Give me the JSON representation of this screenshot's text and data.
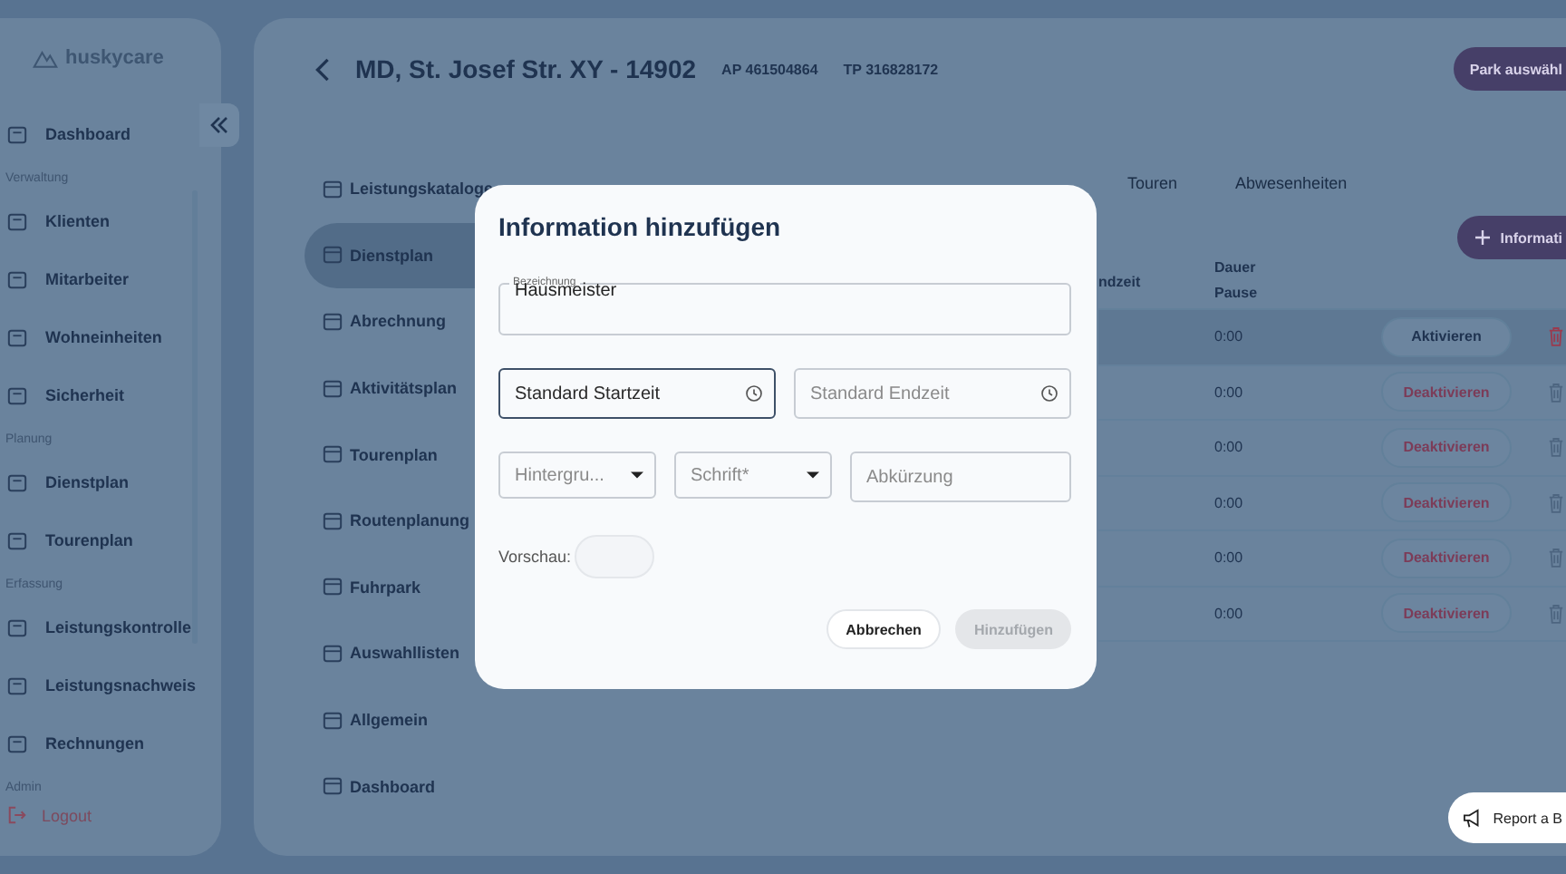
{
  "sidebar": {
    "logo": "huskycare",
    "items": [
      {
        "kind": "item",
        "label": "Dashboard"
      },
      {
        "kind": "section",
        "label": "Verwaltung"
      },
      {
        "kind": "item",
        "label": "Klienten"
      },
      {
        "kind": "item",
        "label": "Mitarbeiter"
      },
      {
        "kind": "item",
        "label": "Wohneinheiten"
      },
      {
        "kind": "item",
        "label": "Sicherheit"
      },
      {
        "kind": "section",
        "label": "Planung"
      },
      {
        "kind": "item",
        "label": "Dienstplan"
      },
      {
        "kind": "item",
        "label": "Tourenplan"
      },
      {
        "kind": "section",
        "label": "Erfassung"
      },
      {
        "kind": "item",
        "label": "Leistungskontrolle"
      },
      {
        "kind": "item",
        "label": "Leistungsnachweis"
      },
      {
        "kind": "item",
        "label": "Rechnungen"
      },
      {
        "kind": "section",
        "label": "Admin"
      }
    ],
    "logout": "Logout"
  },
  "header": {
    "title": "MD, St. Josef Str. XY - 14902",
    "ap": "AP 461504864",
    "tp": "TP 316828172",
    "park_button": "Park auswähl"
  },
  "subnav": [
    {
      "label": "Leistungskataloge",
      "selected": false
    },
    {
      "label": "Dienstplan",
      "selected": true
    },
    {
      "label": "Abrechnung",
      "selected": false
    },
    {
      "label": "Aktivitätsplan",
      "selected": false
    },
    {
      "label": "Tourenplan",
      "selected": false
    },
    {
      "label": "Routenplanung",
      "selected": false
    },
    {
      "label": "Fuhrpark",
      "selected": false
    },
    {
      "label": "Auswahllisten",
      "selected": false
    },
    {
      "label": "Allgemein",
      "selected": false
    },
    {
      "label": "Dashboard",
      "selected": false
    }
  ],
  "tabs": [
    {
      "label": "Touren",
      "selected": false
    },
    {
      "label": "Abwesenheiten",
      "selected": false
    }
  ],
  "add_button": "Informati",
  "table": {
    "columns": [
      "ndzeit",
      "Dauer Pause"
    ],
    "rows": [
      {
        "duration": "0:00",
        "action": "Aktivieren",
        "active": false,
        "selected": true
      },
      {
        "duration": "0:00",
        "action": "Deaktivieren",
        "active": true,
        "selected": false
      },
      {
        "duration": "0:00",
        "action": "Deaktivieren",
        "active": true,
        "selected": false
      },
      {
        "duration": "0:00",
        "action": "Deaktivieren",
        "active": true,
        "selected": false
      },
      {
        "duration": "0:00",
        "action": "Deaktivieren",
        "active": true,
        "selected": false
      },
      {
        "duration": "0:00",
        "action": "Deaktivieren",
        "active": true,
        "selected": false
      }
    ]
  },
  "report_button": "Report a B",
  "dialog": {
    "title": "Information hinzufügen",
    "name_field": {
      "label": "Bezeichnung",
      "value": "Hausmeister"
    },
    "start_field": {
      "placeholder": "Standard Startzeit",
      "focused": true
    },
    "end_field": {
      "placeholder": "Standard Endzeit",
      "focused": false
    },
    "background_select": {
      "placeholder": "Hintergru..."
    },
    "font_select": {
      "placeholder": "Schrift*"
    },
    "abbreviation_field": {
      "placeholder": "Abkürzung"
    },
    "preview_label": "Vorschau:",
    "cancel_button": "Abbrechen",
    "submit_button": {
      "label": "Hinzufügen",
      "disabled": true
    }
  }
}
